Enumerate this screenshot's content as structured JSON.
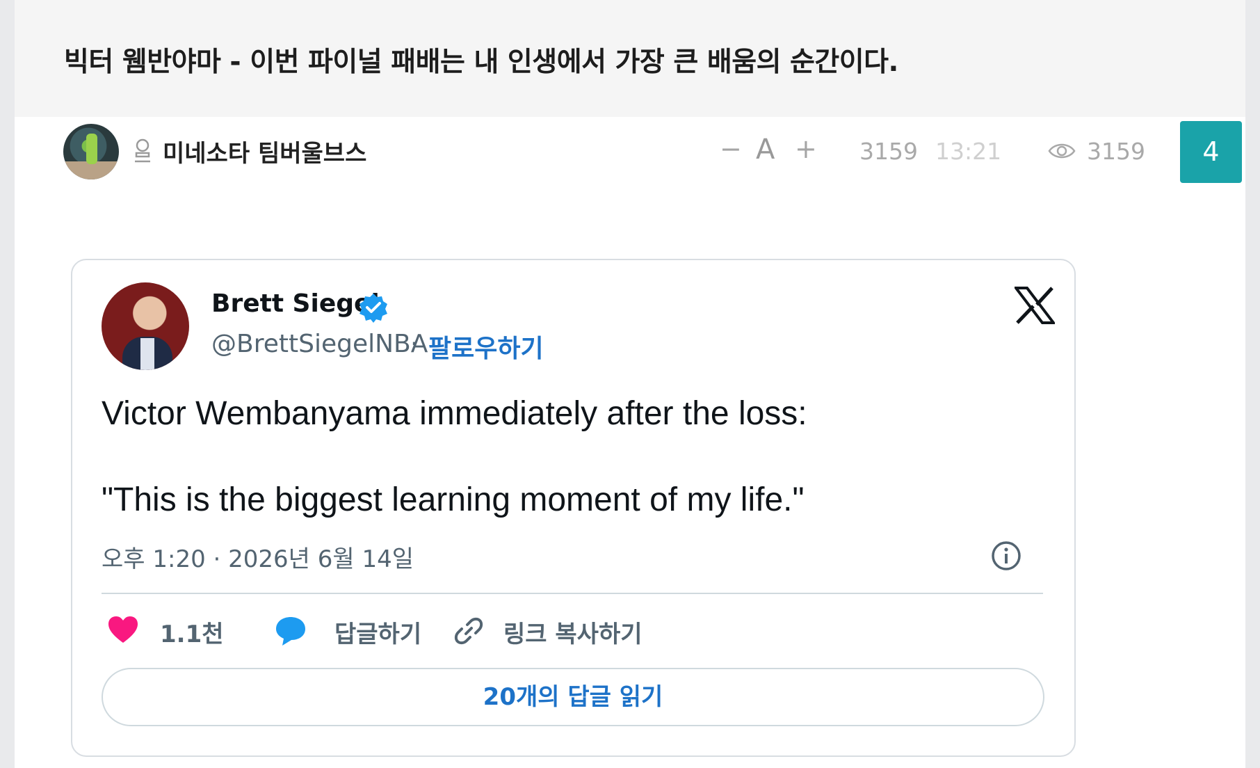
{
  "post": {
    "title": "빅터 웸반야마 - 이번 파이널 패배는 내 인생에서 가장 큰 배움의 순간이다.",
    "author": "미네소타 팀버울브스",
    "font_controls": {
      "minus": "−",
      "a": "A",
      "plus": "+"
    },
    "number": "3159",
    "time": "13:21",
    "views": "3159",
    "comment_count": "4",
    "accent_color": "#1aa3a9"
  },
  "tweet": {
    "name": "Brett Siegel",
    "handle": "@BrettSiegelNBA",
    "separator": "·",
    "follow_label": "팔로우하기",
    "text_line1": "Victor Wembanyama immediately after the loss:",
    "text_line2": "\"This is the biggest learning moment of my life.\"",
    "date": "오후 1:20 · 2026년 6월 14일",
    "like_count": "1.1천",
    "reply_label": "답글하기",
    "copy_link_label": "링크 복사하기",
    "read_replies_label": "20개의 답글 읽기",
    "icons": [
      "verified-badge-icon",
      "x-logo-icon",
      "info-icon",
      "heart-icon",
      "reply-bubble-icon",
      "link-icon"
    ],
    "link_color": "#1d72c8",
    "like_color": "#f91880"
  }
}
